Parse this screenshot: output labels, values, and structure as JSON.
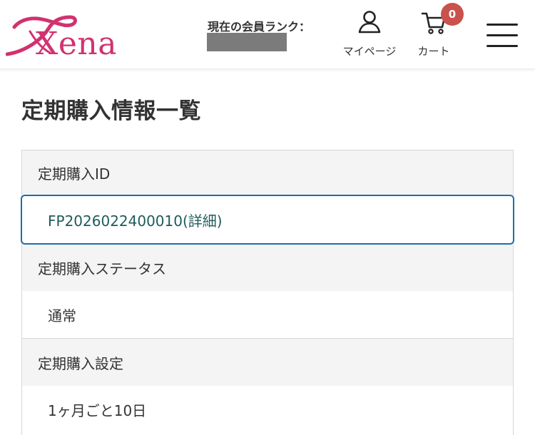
{
  "header": {
    "logo_text": "Xena",
    "rank_label": "現在の会員ランク：",
    "mypage_label": "マイページ",
    "cart_label": "カート",
    "cart_count": "0",
    "brand_color": "#d1326f",
    "badge_color": "#c9524c"
  },
  "main": {
    "title": "定期購入情報一覧",
    "rows": [
      {
        "heading": "定期購入ID",
        "value": "FP2026022400010(詳細)"
      },
      {
        "heading": "定期購入ステータス",
        "value": "通常"
      },
      {
        "heading": "定期購入設定",
        "value": "1ヶ月ごと10日"
      }
    ],
    "link_color": "#1f5b5a",
    "focus_color": "#1c6fa8"
  },
  "icons": {
    "logo": "xena-swoosh-logo",
    "mypage": "user-icon",
    "cart": "cart-icon",
    "menu": "hamburger-menu-icon"
  }
}
